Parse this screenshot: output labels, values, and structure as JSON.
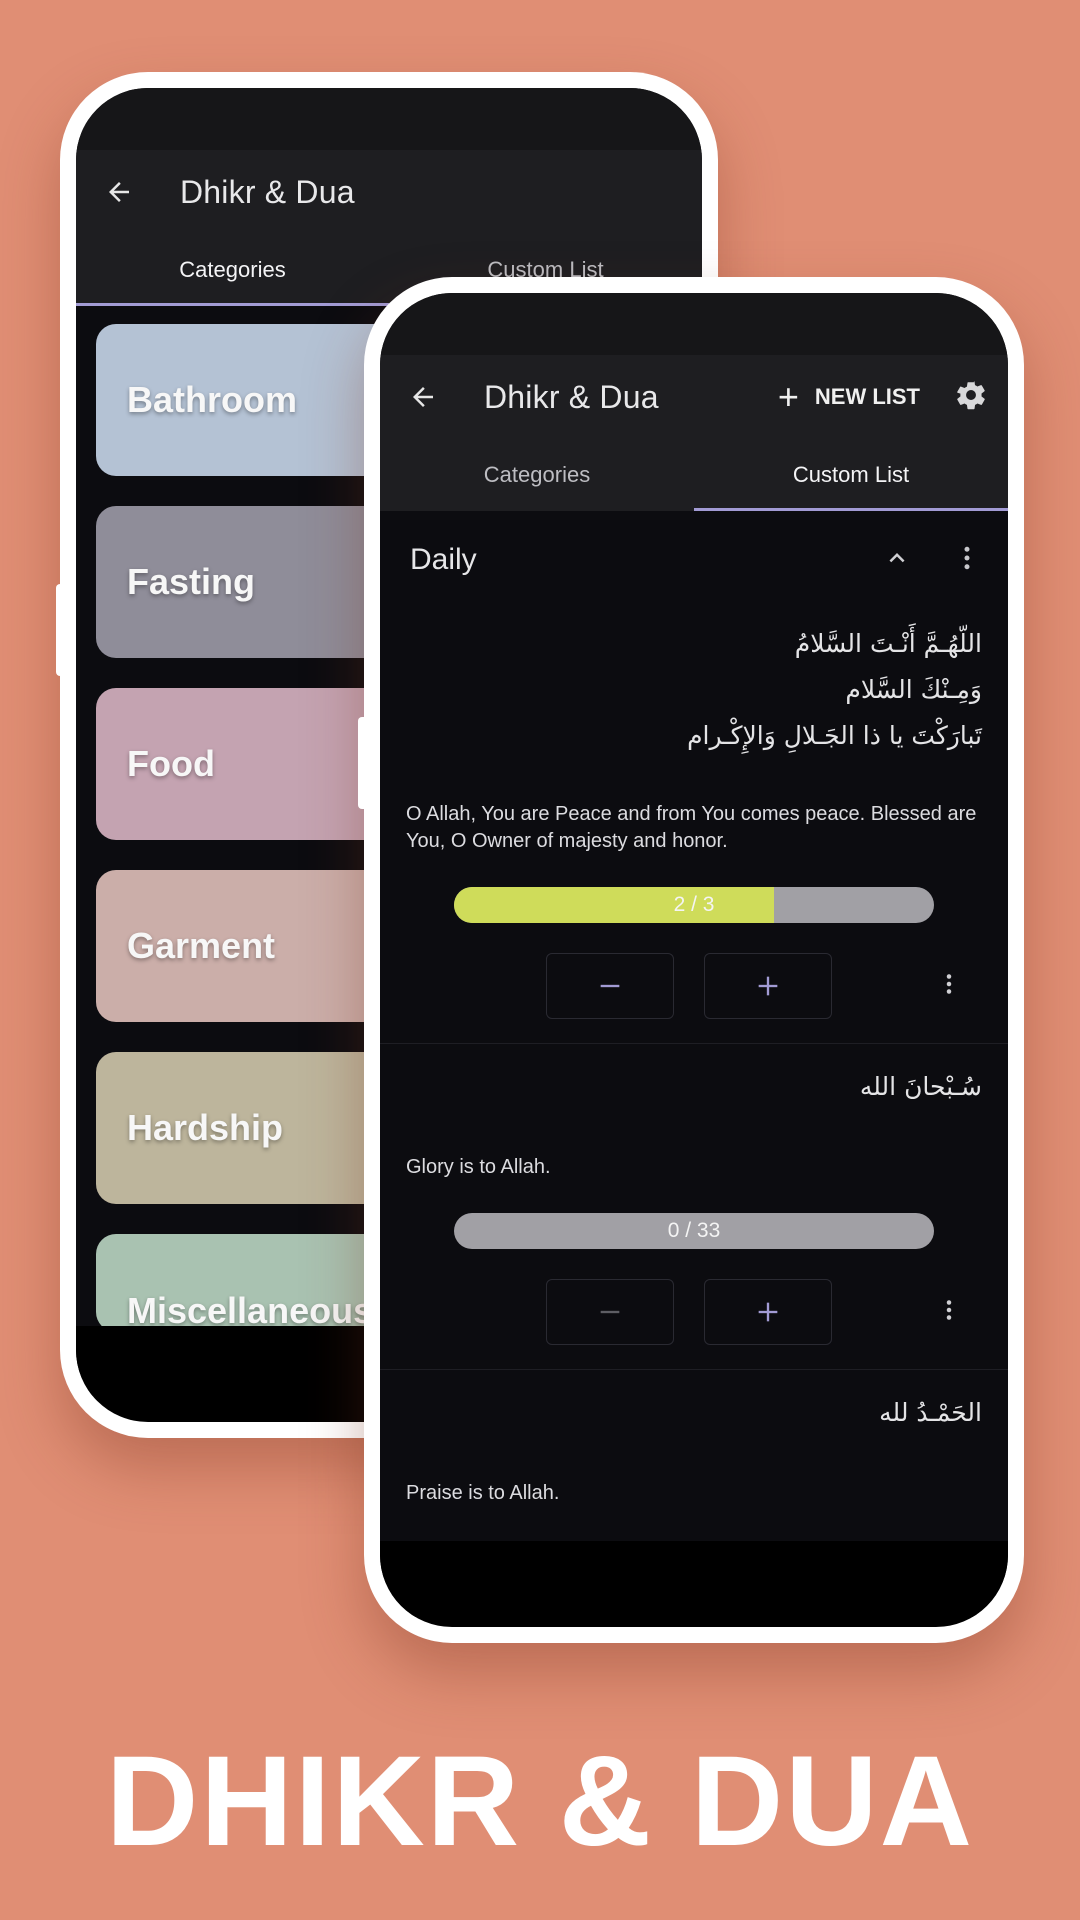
{
  "background_color": "#e08e74",
  "hero_title": "DHIKR & DUA",
  "back_phone": {
    "app_bar": {
      "title": "Dhikr & Dua",
      "back_icon": "arrow-back-icon"
    },
    "tabs": [
      {
        "label": "Categories",
        "active": true
      },
      {
        "label": "Custom List",
        "active": false
      }
    ],
    "categories": [
      {
        "label": "Bathroom",
        "color": "#b4c2d4"
      },
      {
        "label": "Fasting",
        "color": "#8f8d99"
      },
      {
        "label": "Food",
        "color": "#c4a3b1"
      },
      {
        "label": "Garment",
        "color": "#cbaea9"
      },
      {
        "label": "Hardship",
        "color": "#bdb59c"
      },
      {
        "label": "Miscellaneous",
        "color": "#a9c2b1"
      }
    ]
  },
  "front_phone": {
    "app_bar": {
      "title": "Dhikr & Dua",
      "back_icon": "arrow-back-icon",
      "new_list_label": "NEW LIST",
      "settings_icon": "gear-icon"
    },
    "tabs": [
      {
        "label": "Categories",
        "active": false
      },
      {
        "label": "Custom List",
        "active": true
      }
    ],
    "group": {
      "title": "Daily",
      "collapse_icon": "chevron-up-icon",
      "menu_icon": "more-vert-icon"
    },
    "dhikr_items": [
      {
        "arabic": "اللّهُـمَّ أَنْـتَ السَّلامُ\nوَمِـنْكَ السَّلام\nتَبارَكْتَ يا ذا الجَـلالِ وَالإِكْـرام",
        "translation": "O Allah, You are Peace and from You comes peace. Blessed are You, O Owner of majesty and honor.",
        "count": 2,
        "target": 3,
        "progress_label": "2 / 3",
        "progress_color": "#cfdc5a"
      },
      {
        "arabic": "سُـبْحانَ الله",
        "translation": "Glory is to Allah.",
        "count": 0,
        "target": 33,
        "progress_label": "0 / 33",
        "progress_color": "#cfdc5a"
      },
      {
        "arabic": "الحَمْـدُ لله",
        "translation": "Praise is to Allah."
      }
    ],
    "accent_color": "#a29bd4"
  }
}
